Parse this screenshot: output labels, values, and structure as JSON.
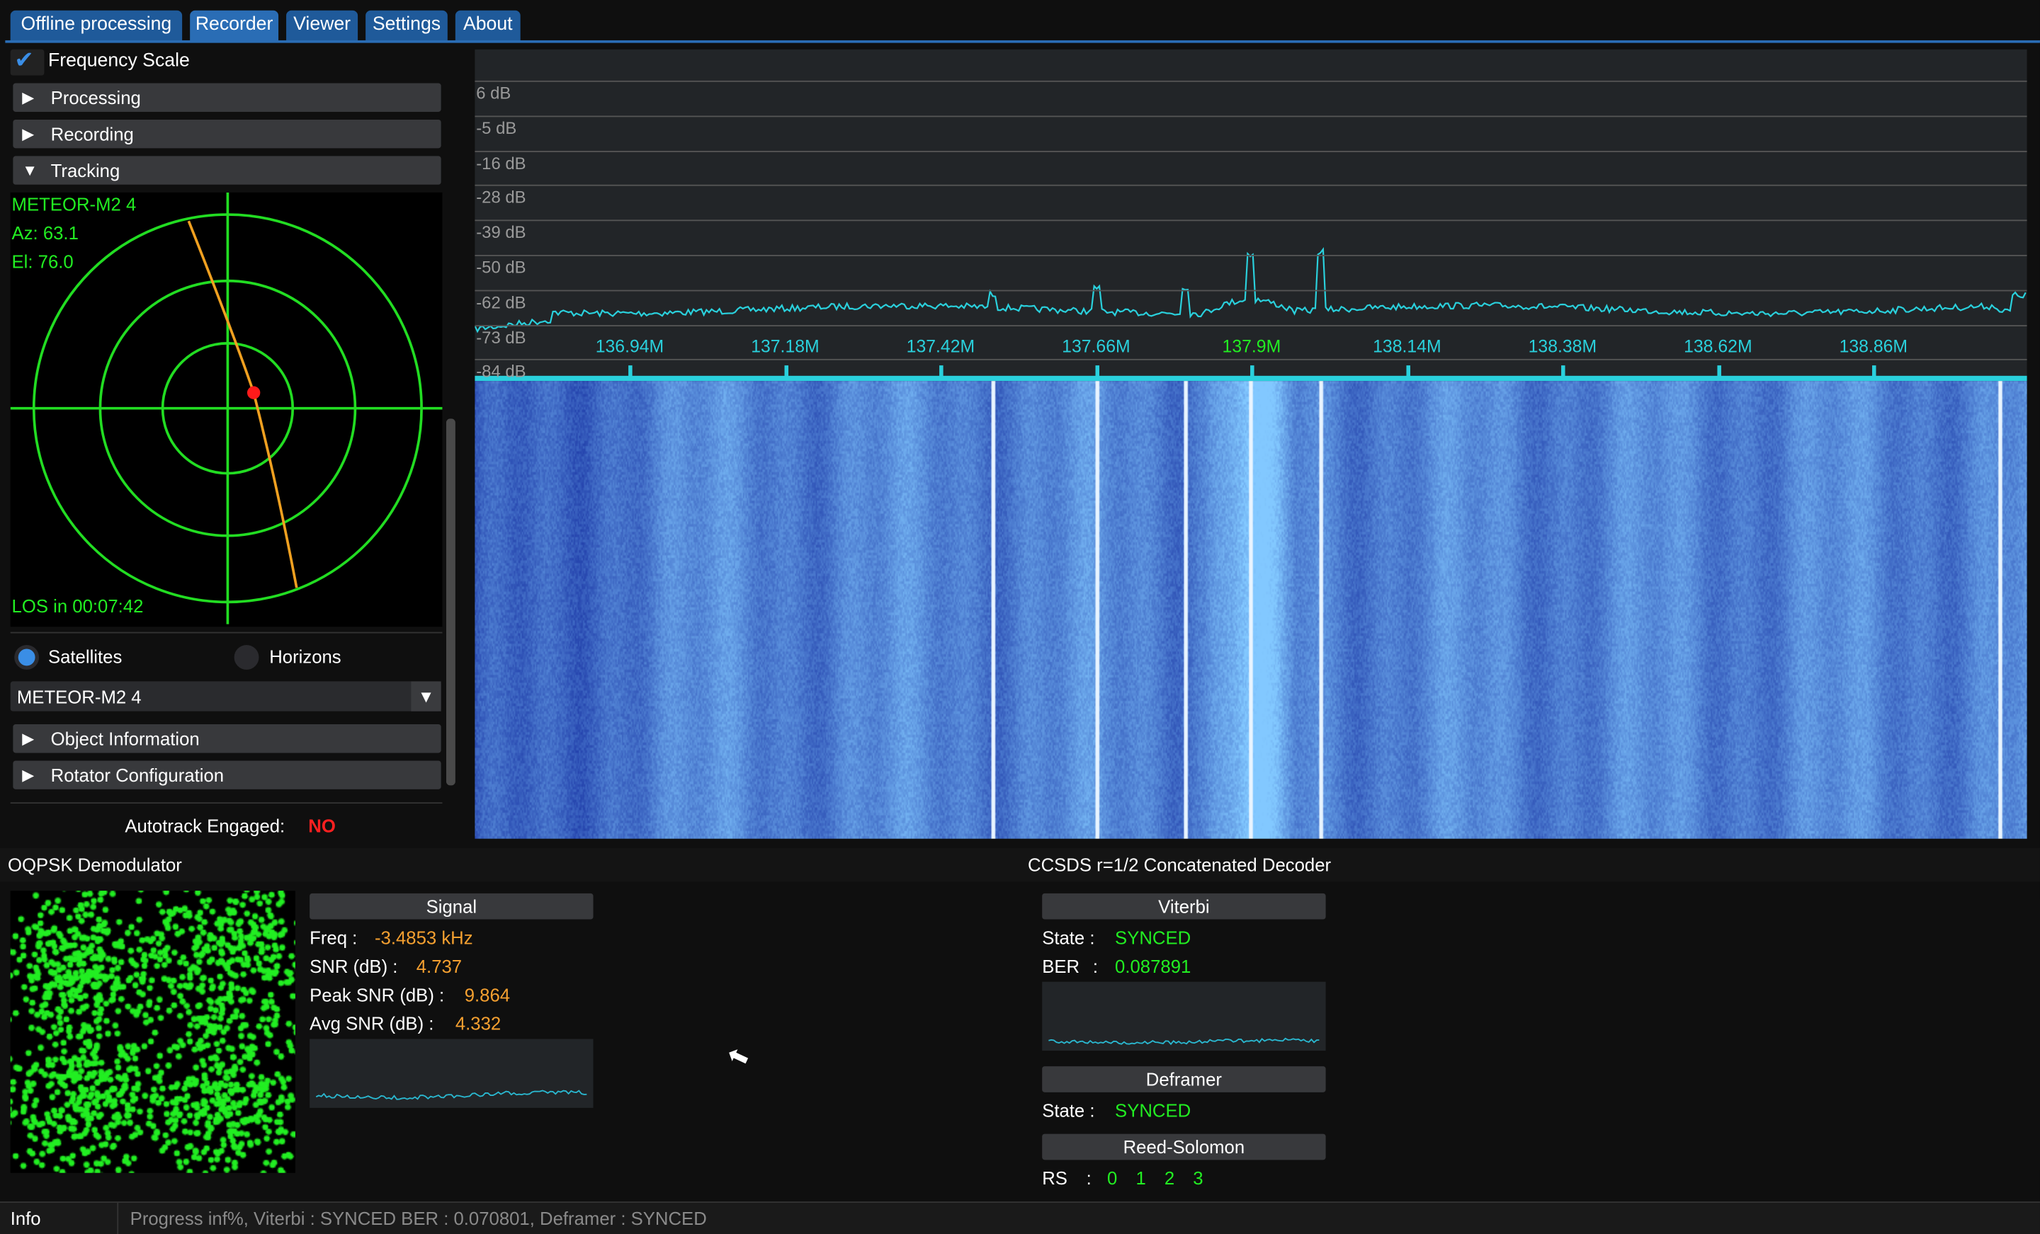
{
  "tabs": [
    {
      "label": "Offline processing"
    },
    {
      "label": "Recorder"
    },
    {
      "label": "Viewer"
    },
    {
      "label": "Settings"
    },
    {
      "label": "About"
    }
  ],
  "active_tab": "Recorder",
  "left_panel": {
    "frequency_scale": {
      "label": "Frequency Scale",
      "checked": true
    },
    "headers": {
      "processing": "Processing",
      "recording": "Recording",
      "tracking": "Tracking",
      "object_info": "Object Information",
      "rotator": "Rotator Configuration"
    },
    "tracking": {
      "satellite": "METEOR-M2 4",
      "az": "Az: 63.1",
      "el": "El: 76.0",
      "los": "LOS in 00:07:42"
    },
    "radios": {
      "satellites": "Satellites",
      "horizons": "Horizons",
      "selected": "Satellites"
    },
    "combo": {
      "value": "METEOR-M2 4"
    },
    "autotrack": {
      "label": "Autotrack Engaged:",
      "value": "NO"
    }
  },
  "fft": {
    "db_labels": [
      "6 dB",
      "-5 dB",
      "-16 dB",
      "-28 dB",
      "-39 dB",
      "-50 dB",
      "-62 dB",
      "-73 dB",
      "-84 dB"
    ],
    "freq_labels": [
      "136.94M",
      "137.18M",
      "137.42M",
      "137.66M",
      "137.9M",
      "138.14M",
      "138.38M",
      "138.62M",
      "138.86M"
    ],
    "center_freq": "137.9M",
    "colors": {
      "trace": "#2ad0dc",
      "center": "#22ee22"
    }
  },
  "demod": {
    "title": "OQPSK Demodulator",
    "signal_header": "Signal",
    "freq": {
      "label": "Freq :",
      "value": "-3.4853 kHz"
    },
    "snr": {
      "label": "SNR (dB) :",
      "value": "4.737"
    },
    "peak_snr": {
      "label": "Peak SNR (dB) :",
      "value": "9.864"
    },
    "avg_snr": {
      "label": "Avg SNR (dB) :",
      "value": "4.332"
    }
  },
  "decoder": {
    "title": "CCSDS r=1/2 Concatenated Decoder",
    "viterbi_header": "Viterbi",
    "viterbi_state": {
      "label": "State :",
      "value": "SYNCED"
    },
    "ber": {
      "label": "BER",
      "sep": ":",
      "value": "0.087891"
    },
    "deframer_header": "Deframer",
    "deframer_state": {
      "label": "State :",
      "value": "SYNCED"
    },
    "rs_header": "Reed-Solomon",
    "rs": {
      "label": "RS",
      "sep": ":",
      "values": [
        "0",
        "1",
        "2",
        "3"
      ]
    }
  },
  "status": {
    "label": "Info",
    "message": "Progress inf%, Viterbi : SYNCED BER : 0.070801, Deframer : SYNCED"
  }
}
